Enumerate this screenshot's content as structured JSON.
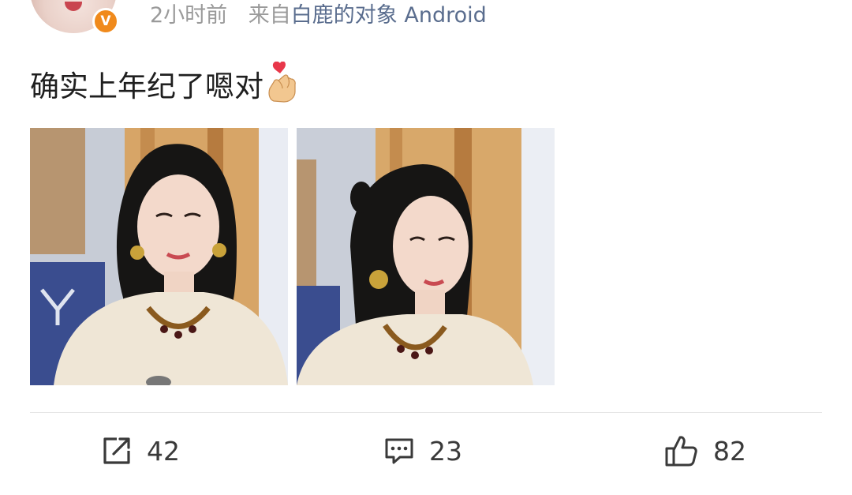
{
  "post": {
    "meta": {
      "time": "2小时前",
      "from_prefix": "来自",
      "source": "白鹿的对象",
      "source_os": "Android"
    },
    "verified_badge": "V",
    "text": "确实上年纪了嗯对",
    "emoji": "finger-heart-emoji",
    "images": [
      {
        "icon": "photo-woman-white-lace-dress"
      },
      {
        "icon": "photo-woman-white-lace-dress-side"
      }
    ]
  },
  "actions": {
    "share": {
      "icon": "share-icon",
      "count": "42"
    },
    "comment": {
      "icon": "comment-icon",
      "count": "23"
    },
    "like": {
      "icon": "thumbs-up-icon",
      "count": "82"
    }
  },
  "colors": {
    "meta_gray": "#9a9a9a",
    "link_blue": "#5a6d8e",
    "verified_orange": "#f08a1c",
    "divider": "#e6e6e6",
    "icon_gray": "#3a3a3a"
  }
}
